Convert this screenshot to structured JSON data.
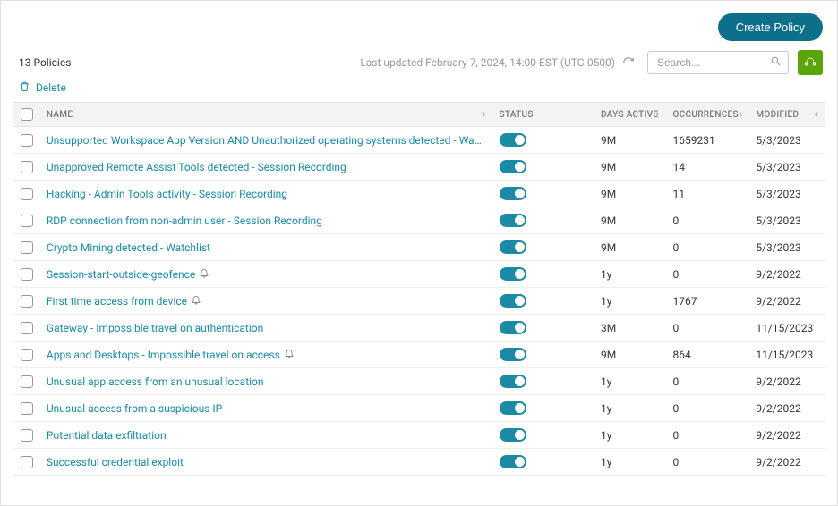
{
  "header": {
    "create_label": "Create Policy",
    "policy_count": "13 Policies",
    "last_updated": "Last updated February 7, 2024, 14:00 EST (UTC-0500)",
    "search_placeholder": "Search...",
    "delete_label": "Delete"
  },
  "columns": {
    "name": "NAME",
    "status": "STATUS",
    "days_active": "DAYS ACTIVE",
    "occurrences": "OCCURRENCES",
    "modified": "MODIFIED"
  },
  "rows": [
    {
      "name": "Unsupported Workspace App Version AND Unauthorized operating systems detected - Watchlist",
      "bell": false,
      "days": "9M",
      "occ": "1659231",
      "mod": "5/3/2023"
    },
    {
      "name": "Unapproved Remote Assist Tools detected - Session Recording",
      "bell": false,
      "days": "9M",
      "occ": "14",
      "mod": "5/3/2023"
    },
    {
      "name": "Hacking - Admin Tools activity - Session Recording",
      "bell": false,
      "days": "9M",
      "occ": "11",
      "mod": "5/3/2023"
    },
    {
      "name": "RDP connection from non-admin user - Session Recording",
      "bell": false,
      "days": "9M",
      "occ": "0",
      "mod": "5/3/2023"
    },
    {
      "name": "Crypto Mining detected - Watchlist",
      "bell": false,
      "days": "9M",
      "occ": "0",
      "mod": "5/3/2023"
    },
    {
      "name": "Session-start-outside-geofence",
      "bell": true,
      "days": "1y",
      "occ": "0",
      "mod": "9/2/2022"
    },
    {
      "name": "First time access from device",
      "bell": true,
      "days": "1y",
      "occ": "1767",
      "mod": "9/2/2022"
    },
    {
      "name": "Gateway - Impossible travel on authentication",
      "bell": false,
      "days": "3M",
      "occ": "0",
      "mod": "11/15/2023"
    },
    {
      "name": "Apps and Desktops - Impossible travel on access",
      "bell": true,
      "days": "9M",
      "occ": "864",
      "mod": "11/15/2023"
    },
    {
      "name": "Unusual app access from an unusual location",
      "bell": false,
      "days": "1y",
      "occ": "0",
      "mod": "9/2/2022"
    },
    {
      "name": "Unusual access from a suspicious IP",
      "bell": false,
      "days": "1y",
      "occ": "0",
      "mod": "9/2/2022"
    },
    {
      "name": "Potential data exfiltration",
      "bell": false,
      "days": "1y",
      "occ": "0",
      "mod": "9/2/2022"
    },
    {
      "name": "Successful credential exploit",
      "bell": false,
      "days": "1y",
      "occ": "0",
      "mod": "9/2/2022"
    }
  ]
}
